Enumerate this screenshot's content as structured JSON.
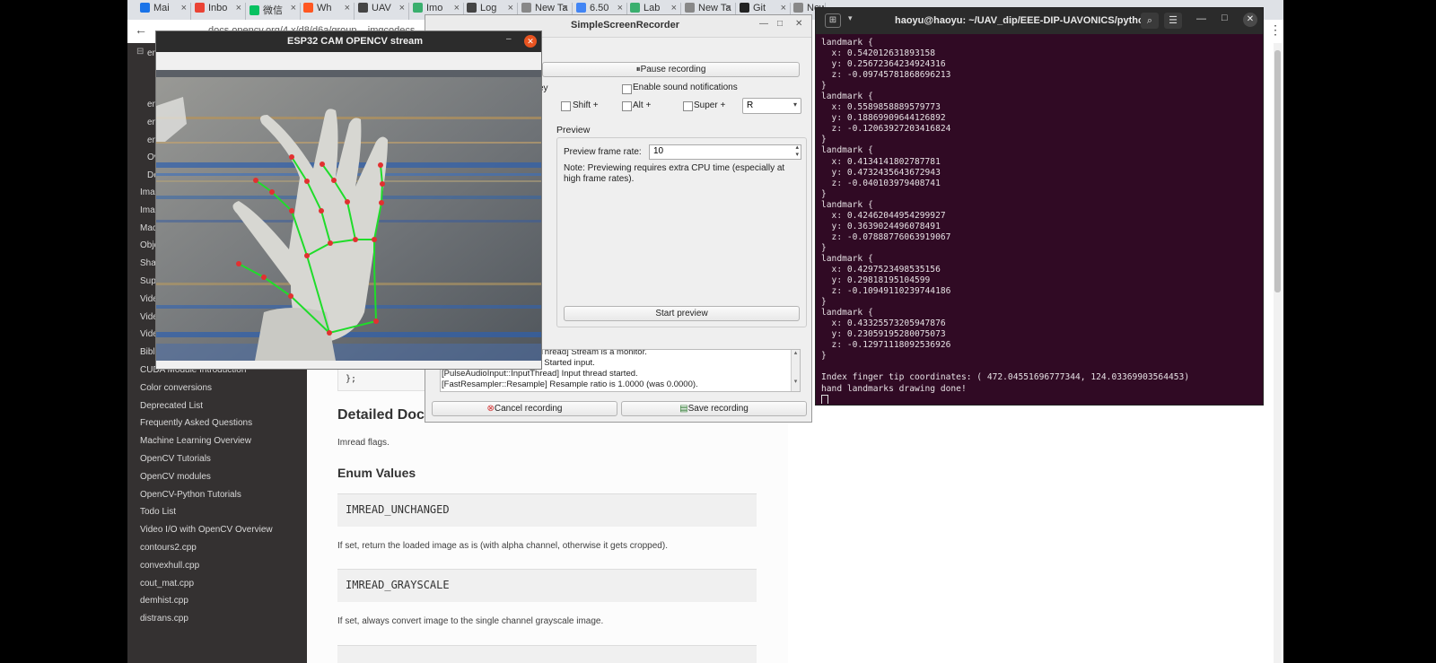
{
  "browser": {
    "tabs": [
      "Mai",
      "Inbo",
      "微信",
      "Wh",
      "UAV",
      "Imo",
      "Log",
      "New Ta",
      "6.50",
      "Lab",
      "New Ta",
      "Git",
      "New Ta"
    ],
    "tab_colors": [
      "#1a73e8",
      "#ea4335",
      "#07c160",
      "#ff5722",
      "#444444",
      "#3aaf6e",
      "#444444",
      "#888888",
      "#4285f4",
      "#3aaf6e",
      "#888888",
      "#222222",
      "#888888"
    ],
    "address": "docs.opencv.org/4.x/d8/d6a/group__imgcodecs__flags.html",
    "sidebar": {
      "partial_items": [
        "en",
        "en",
        "en",
        "en",
        "Ov",
        "De"
      ],
      "items": [
        "Image",
        "Image",
        "Mach",
        "Obje",
        "Shap",
        "Supe",
        "Vide",
        "Vide",
        "Vide",
        "Bibl",
        "CUDA Module Introduction",
        "Color conversions",
        "Deprecated List",
        "Frequently Asked Questions",
        "Machine Learning Overview",
        "OpenCV Tutorials",
        "OpenCV modules",
        "OpenCV-Python Tutorials",
        "Todo List",
        "Video I/O with OpenCV Overview",
        "contours2.cpp",
        "convexhull.cpp",
        "cout_mat.cpp",
        "demhist.cpp",
        "distrans.cpp"
      ]
    },
    "doc": {
      "code_tail": "};",
      "heading": "Detailed Docu",
      "intro": "Imread flags.",
      "enum_heading": "Enum Values",
      "enums": [
        {
          "name": "IMREAD_UNCHANGED",
          "desc": "If set, return the loaded image as is (with alpha channel, otherwise it gets cropped)."
        },
        {
          "name": "IMREAD_GRAYSCALE",
          "desc": "If set, always convert image to the single channel grayscale image."
        }
      ]
    }
  },
  "recorder": {
    "title": "SimpleScreenRecorder",
    "pause_label": "Pause recording",
    "hotkey_partial": "ey",
    "sound_label": "Enable sound notifications",
    "shift_label": "Shift +",
    "alt_label": "Alt +",
    "super_label": "Super +",
    "key_value": "R",
    "preview_heading": "Preview",
    "frame_rate_label": "Preview frame rate:",
    "frame_rate_value": "10",
    "note": "Note: Previewing requires extra CPU time (especially at high frame rates).",
    "start_preview_label": "Start preview",
    "log": [
      "Thread] Stream is a monitor.",
      "] Started input.",
      "[PulseAudioInput::InputThread] Input thread started.",
      "[FastResampler::Resample] Resample ratio is 1.0000 (was 0.0000)."
    ],
    "cancel_label": "Cancel recording",
    "save_label": "Save recording"
  },
  "camera_window": {
    "title": "ESP32 CAM OPENCV stream"
  },
  "terminal": {
    "title": "haoyu@haoyu: ~/UAV_dip/EEE-DIP-UAVONICS/python",
    "lines": [
      "landmark {",
      "  x: 0.542012631893158",
      "  y: 0.25672364234924316",
      "  z: -0.09745781868696213",
      "}",
      "landmark {",
      "  x: 0.5589858889579773",
      "  y: 0.18869909644126892",
      "  z: -0.12063927203416824",
      "}",
      "landmark {",
      "  x: 0.4134141802787781",
      "  y: 0.4732435643672943",
      "  z: -0.040103979408741",
      "}",
      "landmark {",
      "  x: 0.42462044954299927",
      "  y: 0.3639024496078491",
      "  z: -0.07888776063919067",
      "}",
      "landmark {",
      "  x: 0.4297523498535156",
      "  y: 0.29818195104599",
      "  z: -0.10949110239744186",
      "}",
      "landmark {",
      "  x: 0.43325573205947876",
      "  y: 0.23059195280075073",
      "  z: -0.12971118092536926",
      "}",
      "",
      "Index finger tip coordinates: ( 472.04551696777344, 124.03369903564453)",
      "hand landmarks drawing done!"
    ]
  }
}
